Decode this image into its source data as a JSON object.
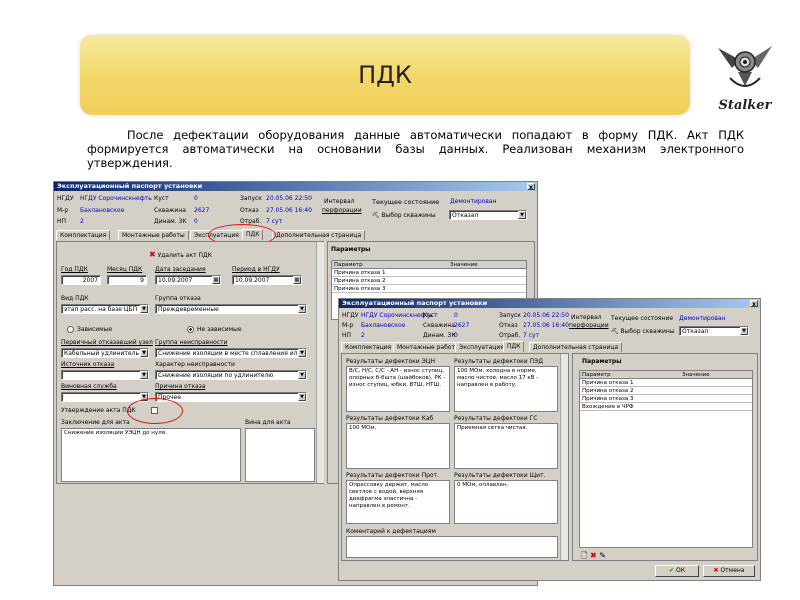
{
  "slide": {
    "title": "ПДК",
    "logo_text": "Stalker",
    "paragraph": "После дефектации оборудования данные автоматически попадают в форму ПДК. Акт ПДК формируется автоматически на основании базы данных. Реализован механизм электронного утверждения."
  },
  "w1": {
    "title": "Эксплуатационный паспорт установки",
    "close": "x",
    "ngdu_label": "НГДУ",
    "ngdu_value": "НГДУ Сорочинскнефть",
    "kust_label": "Куст",
    "kust_value": "0",
    "mr_label": "М-р",
    "mr_value": "Бахлановское",
    "skv_label": "Скважина",
    "skv_value": "2627",
    "np_label": "НП",
    "np_value": "2",
    "din_label": "Динам. ЗК",
    "din_value": "0",
    "zapusk_label": "Запуск",
    "zapusk_value": "20.05.06 22:50",
    "otkaz_label": "Отказ",
    "otkaz_value": "27.05.06 16:40",
    "otrab_label": "Отраб.",
    "otrab_value": "7 сут",
    "interval_label": "Интервал",
    "perf_label": "перфорации",
    "state_label": "Текущее состояние",
    "state_value": "Демонтирован",
    "choose_well": "Выбор скважины",
    "select_value": "Отказал",
    "tabs": [
      "Комплектация",
      "Монтажные работы",
      "Эксплуатация",
      "ПДК",
      "Дополнительная страница"
    ],
    "delete_act": "Удалить акт ПДК",
    "god_label": "Год ПДК",
    "god_value": "2007",
    "mes_label": "Месяц ПДК",
    "mes_value": "9",
    "date_label": "Дата заседания",
    "date_value": "10.09.2007",
    "period_label": "Период в НГДУ",
    "period_value": "10.09.2007",
    "vid_label": "Вид ПДК",
    "vid_value": "этап расс. на базе ЦБП",
    "group_label": "Группа отказа",
    "group_value": "Преждевременные",
    "radio1": "Зависимые",
    "radio2": "Не зависимые",
    "perv_label": "Первичный отказавший узел",
    "perv_value": "Кабельный удлинитель",
    "grn_label": "Группа неисправности",
    "grn_value": "Снижение изоляции в месте сплавления или",
    "ist_label": "Источник отказа",
    "har_label": "Характер неисправности",
    "har_value": "Снижение изоляции по удлинителю",
    "vin_label": "Виновная служба",
    "prich_label": "Причина отказа",
    "prich_value": "Прочее",
    "utv_label": "Утверждение акта ПДК",
    "zakl_label": "Заключение для акта",
    "zakl_value": "Снижение изоляции УЭЦН до нуля.",
    "vina_label": "Вина для акта",
    "params_title": "Параметры",
    "grid_headers": [
      "Параметр",
      "Значение"
    ],
    "grid_rows": [
      "Причина отказа 1",
      "Причина отказа 2",
      "Причина отказа 3"
    ]
  },
  "w2": {
    "title": "Эксплуатационный паспорт установки",
    "close": "x",
    "ngdu_label": "НГДУ",
    "ngdu_value": "НГДУ Сорочинскнефть",
    "kust_label": "Куст",
    "kust_value": "0",
    "mr_label": "М-р",
    "mr_value": "Бахлановское",
    "skv_label": "Скважина",
    "skv_value": "2627",
    "np_label": "НП",
    "np_value": "2",
    "din_label": "Динам. ЗК",
    "din_value": "0",
    "zapusk_label": "Запуск",
    "zapusk_value": "20.05.06 22:50",
    "otkaz_label": "Отказ",
    "otkaz_value": "27.05.06 16:40",
    "otrab_label": "Отраб.",
    "otrab_value": "7 сут",
    "interval_label": "Интервал",
    "perf_label": "перфорации",
    "state_label": "Текущее состояние",
    "state_value": "Демонтирован",
    "choose_well": "Выбор скважины",
    "select_value": "Отказал",
    "tabs": [
      "Комплектация",
      "Монтажные работы",
      "Эксплуатация",
      "ПДК",
      "Дополнительная страница"
    ],
    "res_ecn_label": "Результаты дефектоки ЭЦН",
    "res_ecn_value": "В/С, Н/С, С/С - АН - износ ступиц, опорных б-бшта (шайбоков), РК - износ ступиц, юбки, ВТШ, НТШ.",
    "res_ped_label": "Результаты дефектоки ПЭД",
    "res_ped_value": "100 МОм, холодна в норме, масло чистое, масло 17 кВ - направлен в работу.",
    "res_kab_label": "Результаты дефектоки Каб",
    "res_kab_value": "100 МОм.",
    "res_gs_label": "Результаты дефектоки ГС",
    "res_gs_value": "Приемная сетка чистая.",
    "res_prot_label": "Результаты дефектоки Прот.",
    "res_prot_value": "Опрессовку держит, масло светлое с водой, верхняя диафрагма эластична - направлен в ремонт.",
    "res_shch_label": "Результаты дефектоки Щит.",
    "res_shch_value": "0 МОм, оплавлен.",
    "comment_label": "Коментарий к дефектациям",
    "params_title": "Параметры",
    "grid_headers": [
      "Параметр",
      "Значение"
    ],
    "grid_rows": [
      "Причина отказа 1",
      "Причина отказа 2",
      "Причина отказа 3",
      "Вхождение в ЧРФ"
    ],
    "ok": "ОК",
    "cancel": "Отмена"
  },
  "colors": {
    "banner": "#f2d86a",
    "titlebar": "#0a246a",
    "link": "#0000c0",
    "oval": "#e01010"
  }
}
